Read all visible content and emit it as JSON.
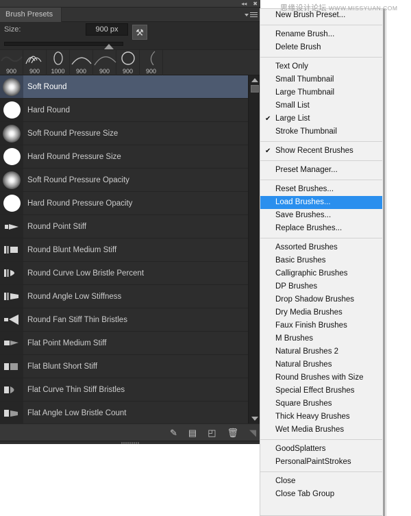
{
  "watermark": {
    "cn": "思缘设计论坛",
    "en": "WWW.MISSYUAN.COM"
  },
  "panel": {
    "tab_label": "Brush Presets",
    "collapse_icon": "double-left-chevron-icon",
    "close_icon": "close-icon",
    "menu_icon": "panel-menu-icon",
    "size": {
      "label": "Size:",
      "value": "900 px",
      "slider_percent": 87,
      "brush_tip_icon": "brush-tip-shape-icon"
    },
    "recent_brushes": [
      {
        "size": "900"
      },
      {
        "size": "900"
      },
      {
        "size": "1000"
      },
      {
        "size": "900"
      },
      {
        "size": "900"
      },
      {
        "size": "900"
      },
      {
        "size": "900"
      }
    ],
    "brushes": [
      {
        "name": "Soft Round",
        "icon": "soft-round-thumbnail",
        "selected": true
      },
      {
        "name": "Hard Round",
        "icon": "hard-round-thumbnail",
        "selected": false
      },
      {
        "name": "Soft Round Pressure Size",
        "icon": "soft-round-thumbnail",
        "selected": false
      },
      {
        "name": "Hard Round Pressure Size",
        "icon": "hard-round-thumbnail",
        "selected": false
      },
      {
        "name": "Soft Round Pressure Opacity",
        "icon": "soft-round-thumbnail",
        "selected": false
      },
      {
        "name": "Hard Round Pressure Opacity",
        "icon": "hard-round-thumbnail",
        "selected": false
      },
      {
        "name": "Round Point Stiff",
        "icon": "bristle-round-point-thumbnail",
        "selected": false
      },
      {
        "name": "Round Blunt Medium Stiff",
        "icon": "bristle-round-blunt-thumbnail",
        "selected": false
      },
      {
        "name": "Round Curve Low Bristle Percent",
        "icon": "bristle-round-curve-thumbnail",
        "selected": false
      },
      {
        "name": "Round Angle Low Stiffness",
        "icon": "bristle-round-angle-thumbnail",
        "selected": false
      },
      {
        "name": "Round Fan Stiff Thin Bristles",
        "icon": "bristle-round-fan-thumbnail",
        "selected": false
      },
      {
        "name": "Flat Point Medium Stiff",
        "icon": "bristle-flat-point-thumbnail",
        "selected": false
      },
      {
        "name": "Flat Blunt Short Stiff",
        "icon": "bristle-flat-blunt-thumbnail",
        "selected": false
      },
      {
        "name": "Flat Curve Thin Stiff Bristles",
        "icon": "bristle-flat-curve-thumbnail",
        "selected": false
      },
      {
        "name": "Flat Angle Low Bristle Count",
        "icon": "bristle-flat-angle-thumbnail",
        "selected": false
      }
    ],
    "footer_icons": [
      {
        "name": "toggle-live-tip-brush-icon",
        "glyph": "✎"
      },
      {
        "name": "open-preset-manager-icon",
        "glyph": "▤"
      },
      {
        "name": "create-new-brush-icon",
        "glyph": "◰"
      },
      {
        "name": "delete-brush-icon",
        "glyph": "🗑"
      },
      {
        "name": "resize-grip-icon",
        "glyph": "◥"
      }
    ],
    "scrollbar": {
      "up_arrow": "scroll-up-arrow-icon",
      "down_arrow": "scroll-down-arrow-icon"
    }
  },
  "flyout_menu": {
    "groups": [
      {
        "items": [
          {
            "label": "New Brush Preset...",
            "checked": false,
            "highlighted": false
          }
        ]
      },
      {
        "items": [
          {
            "label": "Rename Brush...",
            "checked": false,
            "highlighted": false
          },
          {
            "label": "Delete Brush",
            "checked": false,
            "highlighted": false
          }
        ]
      },
      {
        "items": [
          {
            "label": "Text Only",
            "checked": false,
            "highlighted": false
          },
          {
            "label": "Small Thumbnail",
            "checked": false,
            "highlighted": false
          },
          {
            "label": "Large Thumbnail",
            "checked": false,
            "highlighted": false
          },
          {
            "label": "Small List",
            "checked": false,
            "highlighted": false
          },
          {
            "label": "Large List",
            "checked": true,
            "highlighted": false
          },
          {
            "label": "Stroke Thumbnail",
            "checked": false,
            "highlighted": false
          }
        ]
      },
      {
        "items": [
          {
            "label": "Show Recent Brushes",
            "checked": true,
            "highlighted": false
          }
        ]
      },
      {
        "items": [
          {
            "label": "Preset Manager...",
            "checked": false,
            "highlighted": false
          }
        ]
      },
      {
        "items": [
          {
            "label": "Reset Brushes...",
            "checked": false,
            "highlighted": false
          },
          {
            "label": "Load Brushes...",
            "checked": false,
            "highlighted": true
          },
          {
            "label": "Save Brushes...",
            "checked": false,
            "highlighted": false
          },
          {
            "label": "Replace Brushes...",
            "checked": false,
            "highlighted": false
          }
        ]
      },
      {
        "items": [
          {
            "label": "Assorted Brushes",
            "checked": false,
            "highlighted": false
          },
          {
            "label": "Basic Brushes",
            "checked": false,
            "highlighted": false
          },
          {
            "label": "Calligraphic Brushes",
            "checked": false,
            "highlighted": false
          },
          {
            "label": "DP Brushes",
            "checked": false,
            "highlighted": false
          },
          {
            "label": "Drop Shadow Brushes",
            "checked": false,
            "highlighted": false
          },
          {
            "label": "Dry Media Brushes",
            "checked": false,
            "highlighted": false
          },
          {
            "label": "Faux Finish Brushes",
            "checked": false,
            "highlighted": false
          },
          {
            "label": "M Brushes",
            "checked": false,
            "highlighted": false
          },
          {
            "label": "Natural Brushes 2",
            "checked": false,
            "highlighted": false
          },
          {
            "label": "Natural Brushes",
            "checked": false,
            "highlighted": false
          },
          {
            "label": "Round Brushes with Size",
            "checked": false,
            "highlighted": false
          },
          {
            "label": "Special Effect Brushes",
            "checked": false,
            "highlighted": false
          },
          {
            "label": "Square Brushes",
            "checked": false,
            "highlighted": false
          },
          {
            "label": "Thick Heavy Brushes",
            "checked": false,
            "highlighted": false
          },
          {
            "label": "Wet Media Brushes",
            "checked": false,
            "highlighted": false
          }
        ]
      },
      {
        "items": [
          {
            "label": "GoodSplatters",
            "checked": false,
            "highlighted": false
          },
          {
            "label": "PersonalPaintStrokes",
            "checked": false,
            "highlighted": false
          }
        ]
      },
      {
        "items": [
          {
            "label": "Close",
            "checked": false,
            "highlighted": false
          },
          {
            "label": "Close Tab Group",
            "checked": false,
            "highlighted": false
          }
        ]
      }
    ]
  },
  "colors": {
    "panel_bg": "#2b2b2b",
    "selection_blue_gray": "#4d5a70",
    "menu_bg": "#f1f1f1",
    "menu_highlight": "#2a8fee",
    "text_light": "#cdcdcd"
  }
}
